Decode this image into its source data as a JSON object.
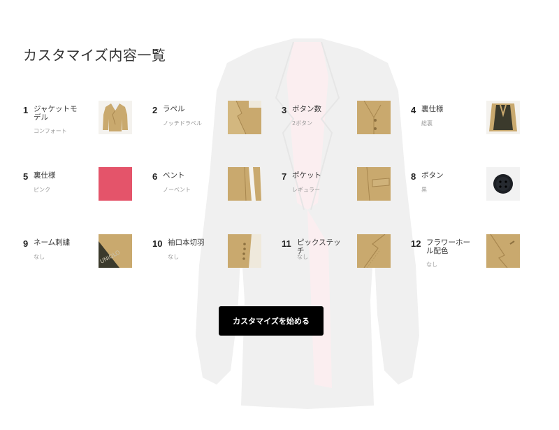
{
  "page": {
    "title": "カスタマイズ内容一覧"
  },
  "items": [
    {
      "number": "1",
      "label": "ジャケットモデル",
      "value": "コンフォート"
    },
    {
      "number": "2",
      "label": "ラペル",
      "value": "ノッチドラペル"
    },
    {
      "number": "3",
      "label": "ボタン数",
      "value": "2ボタン"
    },
    {
      "number": "4",
      "label": "裏仕様",
      "value": "総裏"
    },
    {
      "number": "5",
      "label": "裏仕様",
      "value": "ピンク"
    },
    {
      "number": "6",
      "label": "ベント",
      "value": "ノーベント"
    },
    {
      "number": "7",
      "label": "ポケット",
      "value": "レギュラー"
    },
    {
      "number": "8",
      "label": "ボタン",
      "value": "黒"
    },
    {
      "number": "9",
      "label": "ネーム刺繍",
      "value": "なし"
    },
    {
      "number": "10",
      "label": "袖口本切羽",
      "value": "なし"
    },
    {
      "number": "11",
      "label": "ピックステッチ",
      "value": "なし"
    },
    {
      "number": "12",
      "label": "フラワーホール配色",
      "value": "なし"
    }
  ],
  "thumb_text": {
    "embroidery": "UNIQLO"
  },
  "cta": {
    "label": "カスタマイズを始める"
  },
  "colors": {
    "fabric": "#c9a96e",
    "fabric_dark": "#a8874f",
    "pink_lining": "#e4546a",
    "button_black": "#1c1f24",
    "lining_dark": "#3b3a2c",
    "cta_bg": "#000000"
  }
}
